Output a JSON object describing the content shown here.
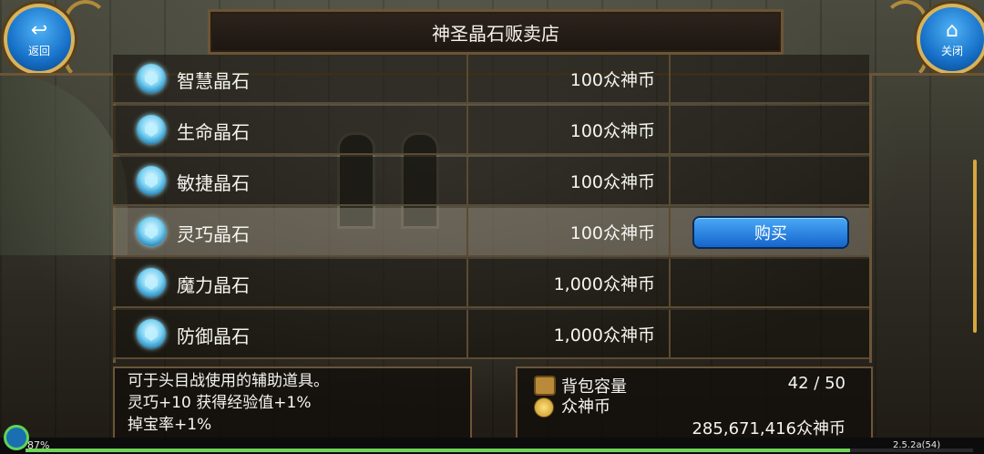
{
  "header": {
    "title": "神圣晶石贩卖店",
    "back_icon": "return-arrow-icon",
    "back_label": "返回",
    "close_icon": "home-icon",
    "close_label": "关闭"
  },
  "shop": {
    "items": [
      {
        "name": "智慧晶石",
        "price": "100众神币",
        "icon": "crystal-icon"
      },
      {
        "name": "生命晶石",
        "price": "100众神币",
        "icon": "crystal-icon"
      },
      {
        "name": "敏捷晶石",
        "price": "100众神币",
        "icon": "crystal-icon"
      },
      {
        "name": "灵巧晶石",
        "price": "100众神币",
        "icon": "crystal-icon",
        "selected": true
      },
      {
        "name": "魔力晶石",
        "price": "1,000众神币",
        "icon": "crystal-icon"
      },
      {
        "name": "防御晶石",
        "price": "1,000众神币",
        "icon": "crystal-icon"
      }
    ],
    "buy_label": "购买"
  },
  "description": {
    "lines": [
      "可于头目战使用的辅助道具。",
      "灵巧+10 获得经验值+1%",
      "掉宝率+1%"
    ]
  },
  "inventory": {
    "bag_label": "背包容量",
    "bag_value": "42 / 50",
    "currency_label": "众神币",
    "currency_value": "285,671,416众神币"
  },
  "status": {
    "battery": "87%",
    "version": "2.5.2a(54)",
    "xp_progress": 0.87
  },
  "colors": {
    "accent_blue": "#1670c8",
    "frame_gold": "#6b5537",
    "buy_button": "#1565cc"
  }
}
